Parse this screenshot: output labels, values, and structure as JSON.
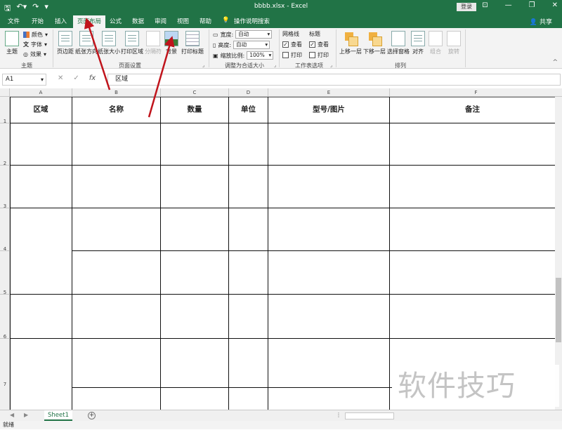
{
  "window": {
    "title": "bbbb.xlsx  -  Excel",
    "login": "登录",
    "share": "共享"
  },
  "tabs": [
    "文件",
    "开始",
    "插入",
    "页面布局",
    "公式",
    "数据",
    "审阅",
    "视图",
    "帮助"
  ],
  "active_tab": "页面布局",
  "tell_me": "操作说明搜索",
  "ribbon": {
    "themes": {
      "main": "主题",
      "colors": "颜色",
      "fonts": "字体",
      "effects": "效果",
      "group": "主题"
    },
    "page_setup": {
      "margins": "页边距",
      "orientation": "纸张方向",
      "size": "纸张大小",
      "print_area": "打印区域",
      "breaks": "分隔符",
      "background": "背景",
      "print_titles": "打印标题",
      "group": "页面设置"
    },
    "scale": {
      "width_label": "宽度:",
      "width_value": "自动",
      "height_label": "高度:",
      "height_value": "自动",
      "scale_label": "缩放比例:",
      "scale_value": "100%",
      "group": "调整为合适大小"
    },
    "sheet_options": {
      "gridlines": "网格线",
      "headings": "标题",
      "view": "查看",
      "print": "打印",
      "group": "工作表选项",
      "gridlines_view": true,
      "gridlines_print": false,
      "headings_view": true,
      "headings_print": false
    },
    "arrange": {
      "bring_forward": "上移一层",
      "send_backward": "下移一层",
      "selection_pane": "选择窗格",
      "align": "对齐",
      "group_objects": "组合",
      "rotate": "旋转",
      "group": "排列"
    }
  },
  "formula_bar": {
    "name_box": "A1",
    "formula": "区域"
  },
  "columns": [
    "A",
    "B",
    "C",
    "D",
    "E",
    "F"
  ],
  "rows": [
    "1",
    "2",
    "3",
    "4",
    "5",
    "6",
    "7"
  ],
  "table_headers": [
    "区域",
    "名称",
    "数量",
    "单位",
    "型号/图片",
    "备注"
  ],
  "sheet_tab": "Sheet1",
  "status": "就绪",
  "watermark": "软件技巧",
  "colors": {
    "excel_green": "#217346",
    "arrow": "#c0141c"
  }
}
